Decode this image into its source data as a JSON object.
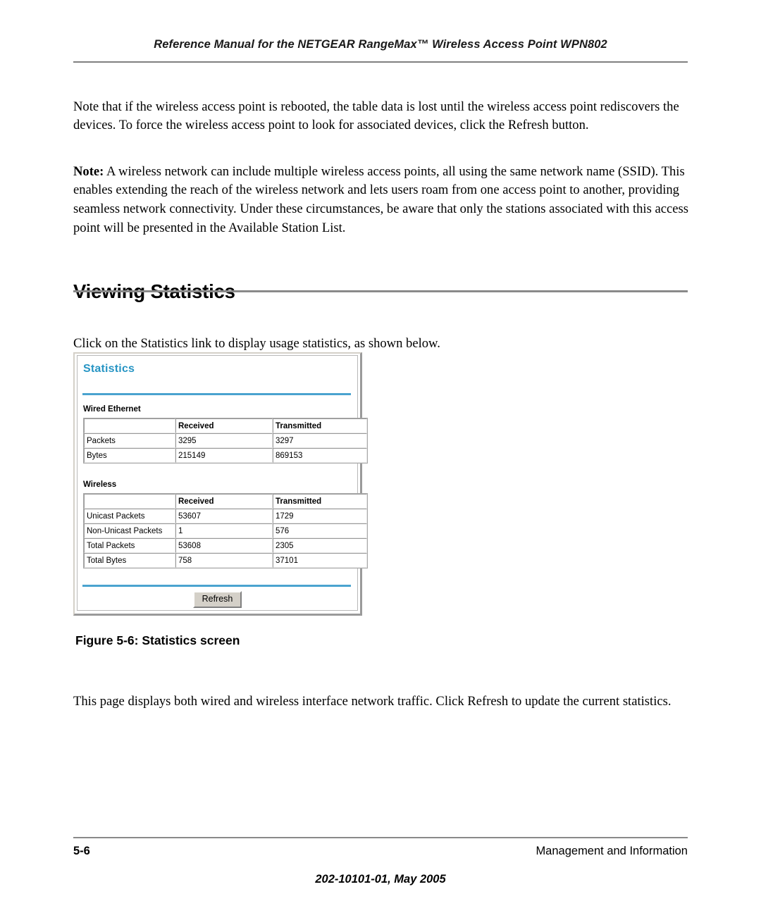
{
  "header": {
    "running_title": "Reference Manual for the NETGEAR RangeMax™ Wireless Access Point WPN802"
  },
  "body": {
    "paragraph_reboot": "Note that if the wireless access point is rebooted, the table data is lost until the wireless access point rediscovers the devices. To force the wireless access point to look for associated devices, click the Refresh button.",
    "note_label": "Note:",
    "note_text": " A wireless network can include multiple wireless access points, all using the same network name (SSID). This enables extending the reach of the wireless network and lets users roam from one access point to another, providing seamless network connectivity. Under these circumstances, be aware that only the stations associated with this access point will be presented in the Available Station List.",
    "section_heading": "Viewing Statistics",
    "paragraph_click_stats": "Click on the Statistics link to display usage statistics, as shown below.",
    "figure_caption": "Figure 5-6:  Statistics screen",
    "paragraph_page_displays": "This page displays both wired and wireless interface network traffic. Click Refresh to update the current statistics."
  },
  "screenshot": {
    "title": "Statistics",
    "accent_color": "#2795c4",
    "rule_color": "#4aa3cf",
    "wired": {
      "group_label": "Wired Ethernet",
      "columns": [
        "",
        "Received",
        "Transmitted"
      ],
      "rows": [
        {
          "label": "Packets",
          "received": "3295",
          "transmitted": "3297"
        },
        {
          "label": "Bytes",
          "received": "215149",
          "transmitted": "869153"
        }
      ]
    },
    "wireless": {
      "group_label": "Wireless",
      "columns": [
        "",
        "Received",
        "Transmitted"
      ],
      "rows": [
        {
          "label": "Unicast Packets",
          "received": "53607",
          "transmitted": "1729"
        },
        {
          "label": "Non-Unicast Packets",
          "received": "1",
          "transmitted": "576"
        },
        {
          "label": "Total Packets",
          "received": "53608",
          "transmitted": "2305"
        },
        {
          "label": "Total Bytes",
          "received": "758",
          "transmitted": "37101"
        }
      ]
    },
    "refresh_label": "Refresh"
  },
  "footer": {
    "page_number": "5-6",
    "chapter_title": "Management and Information",
    "doc_id": "202-10101-01, May 2005"
  }
}
